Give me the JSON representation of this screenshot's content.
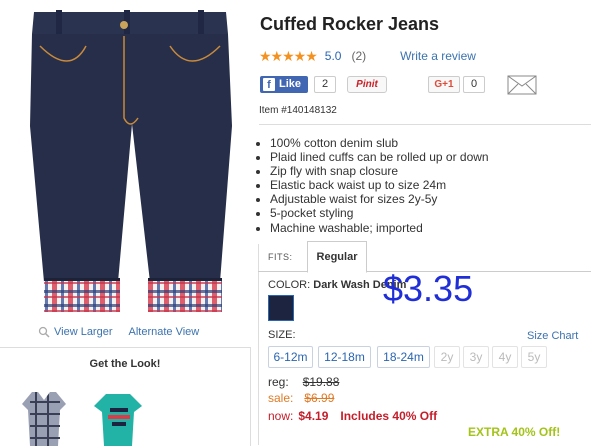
{
  "product": {
    "title": "Cuffed Rocker Jeans",
    "rating": {
      "stars": "★★★★★",
      "score": "5.0",
      "count": "(2)",
      "write_review": "Write a review"
    },
    "social": {
      "like_label": "Like",
      "like_count": "2",
      "pinit_label": "Pinit",
      "gplus_label": "G+1",
      "gplus_count": "0"
    },
    "item_number": "Item #140148132",
    "features": [
      "100% cotton denim slub",
      "Plaid lined cuffs can be rolled up or down",
      "Zip fly with snap closure",
      "Elastic back waist up to size 24m",
      "Adjustable waist for sizes 2y-5y",
      "5-pocket styling",
      "Machine washable; imported"
    ]
  },
  "image_links": {
    "view_larger": "View Larger",
    "alternate_view": "Alternate View"
  },
  "get_the_look": {
    "title": "Get the Look!"
  },
  "options": {
    "fits_label": "FITS:",
    "fit_tab": "Regular",
    "color_label": "COLOR:",
    "color_value": "Dark Wash Denim",
    "overlay_price": "$3.35",
    "size_label": "SIZE:",
    "size_chart": "Size Chart",
    "sizes": [
      {
        "label": "6-12m",
        "available": true
      },
      {
        "label": "12-18m",
        "available": true
      },
      {
        "label": "18-24m",
        "available": true
      },
      {
        "label": "2y",
        "available": false
      },
      {
        "label": "3y",
        "available": false
      },
      {
        "label": "4y",
        "available": false
      },
      {
        "label": "5y",
        "available": false
      }
    ]
  },
  "pricing": {
    "reg_label": "reg:",
    "reg_value": "$19.88",
    "sale_label": "sale:",
    "sale_value": "$6.99",
    "now_label": "now:",
    "now_value": "$4.19",
    "now_note": "Includes 40% Off",
    "extra": "EXTRA 40% Off!"
  },
  "colors": {
    "link": "#3b73af",
    "star": "#f5911f",
    "sale": "#e07a26",
    "now": "#c41e2b",
    "extra": "#a3c31a",
    "overlay": "#1f2ed6"
  }
}
